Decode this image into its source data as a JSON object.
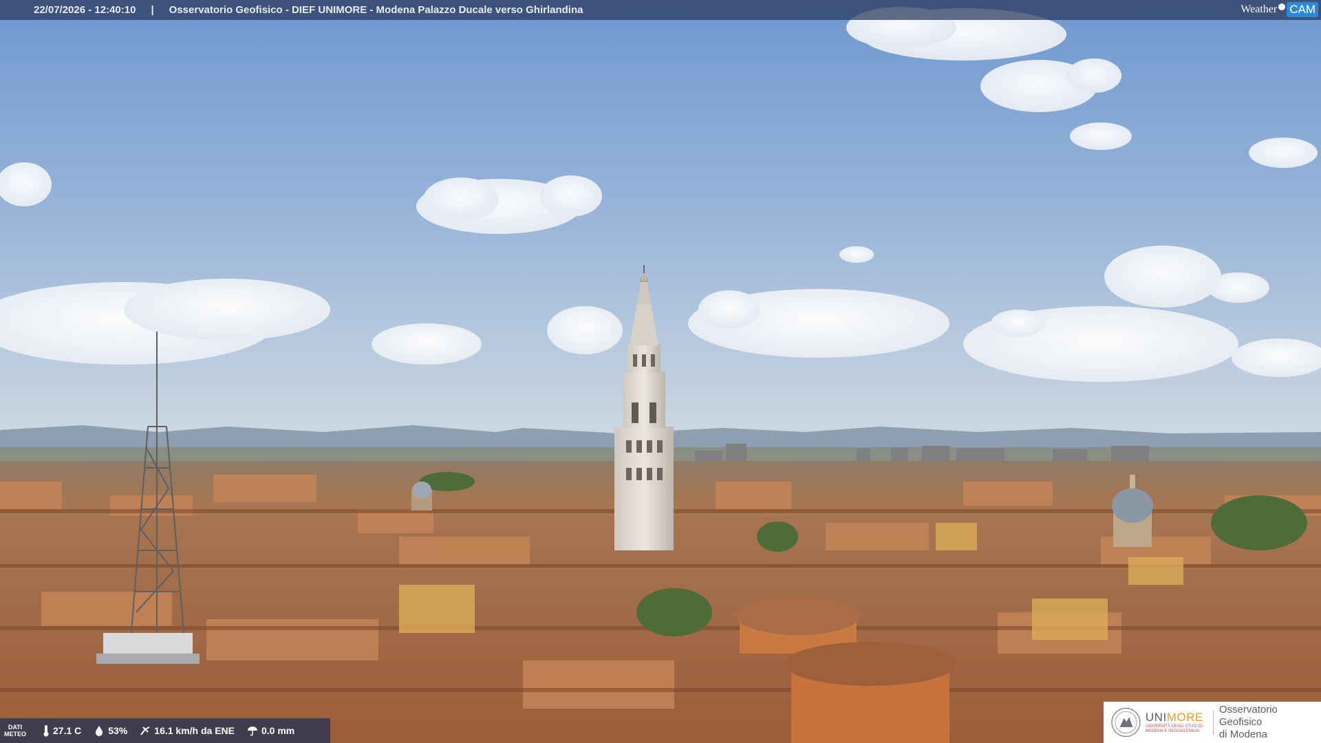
{
  "header": {
    "timestamp": "22/07/2026 - 12:40:10",
    "separator": "|",
    "title": "Osservatorio Geofisico - DIEF UNIMORE - Modena Palazzo Ducale verso Ghirlandina"
  },
  "brand": {
    "part1": "Weather",
    "part2": "CAM"
  },
  "meteo": {
    "label_line1": "DATI",
    "label_line2": "METEO",
    "temperature": "27.1 C",
    "humidity": "53%",
    "wind": "16.1 km/h da ENE",
    "rain": "0.0 mm"
  },
  "logo": {
    "uni_prefix": "UNI",
    "uni_suffix": "MORE",
    "uni_sub": "UNIVERSITÀ DEGLI STUDI DI MODENA E REGGIO EMILIA",
    "obs_line1": "Osservatorio Geofisico",
    "obs_line2": "di Modena"
  },
  "colors": {
    "sky_top": "#7fa3d3",
    "sky_horizon": "#c9d6e3",
    "roof": "#b6754a",
    "tower": "#e8e2d8",
    "accent_orange": "#f39a1f",
    "weathercam_blue": "#2e88d8"
  }
}
